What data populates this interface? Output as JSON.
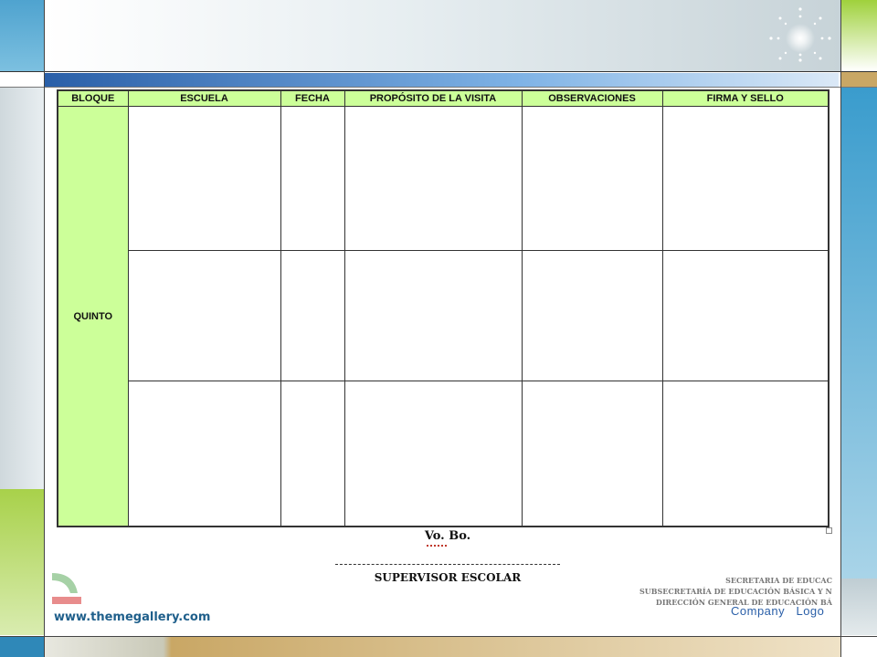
{
  "table": {
    "headers": [
      "BLOQUE",
      "ESCUELA",
      "FECHA",
      "PROPÓSITO DE LA VISITA",
      "OBSERVACIONES",
      "FIRMA Y SELLO"
    ],
    "bloque_value": "QUINTO",
    "row_count": 3,
    "header_color": "#ccff99"
  },
  "signature": {
    "vobo": "Vo. Bo.",
    "supervisor": "SUPERVISOR ESCOLAR"
  },
  "secretaria": {
    "line1": "SECRETARIA DE EDUCAC",
    "line2": "SUBSECRETARÍA DE EDUCACIÓN BÁSICA Y NOR",
    "line3": "DIRECCIÓN GENERAL DE EDUCACIÓN BÁ"
  },
  "footer": {
    "website": "www.themegallery.com",
    "company_logo": "Company   Logo"
  },
  "colors": {
    "accent_blue": "#2a5fa8",
    "accent_green": "#a8d14a",
    "accent_gold": "#c9a765"
  }
}
